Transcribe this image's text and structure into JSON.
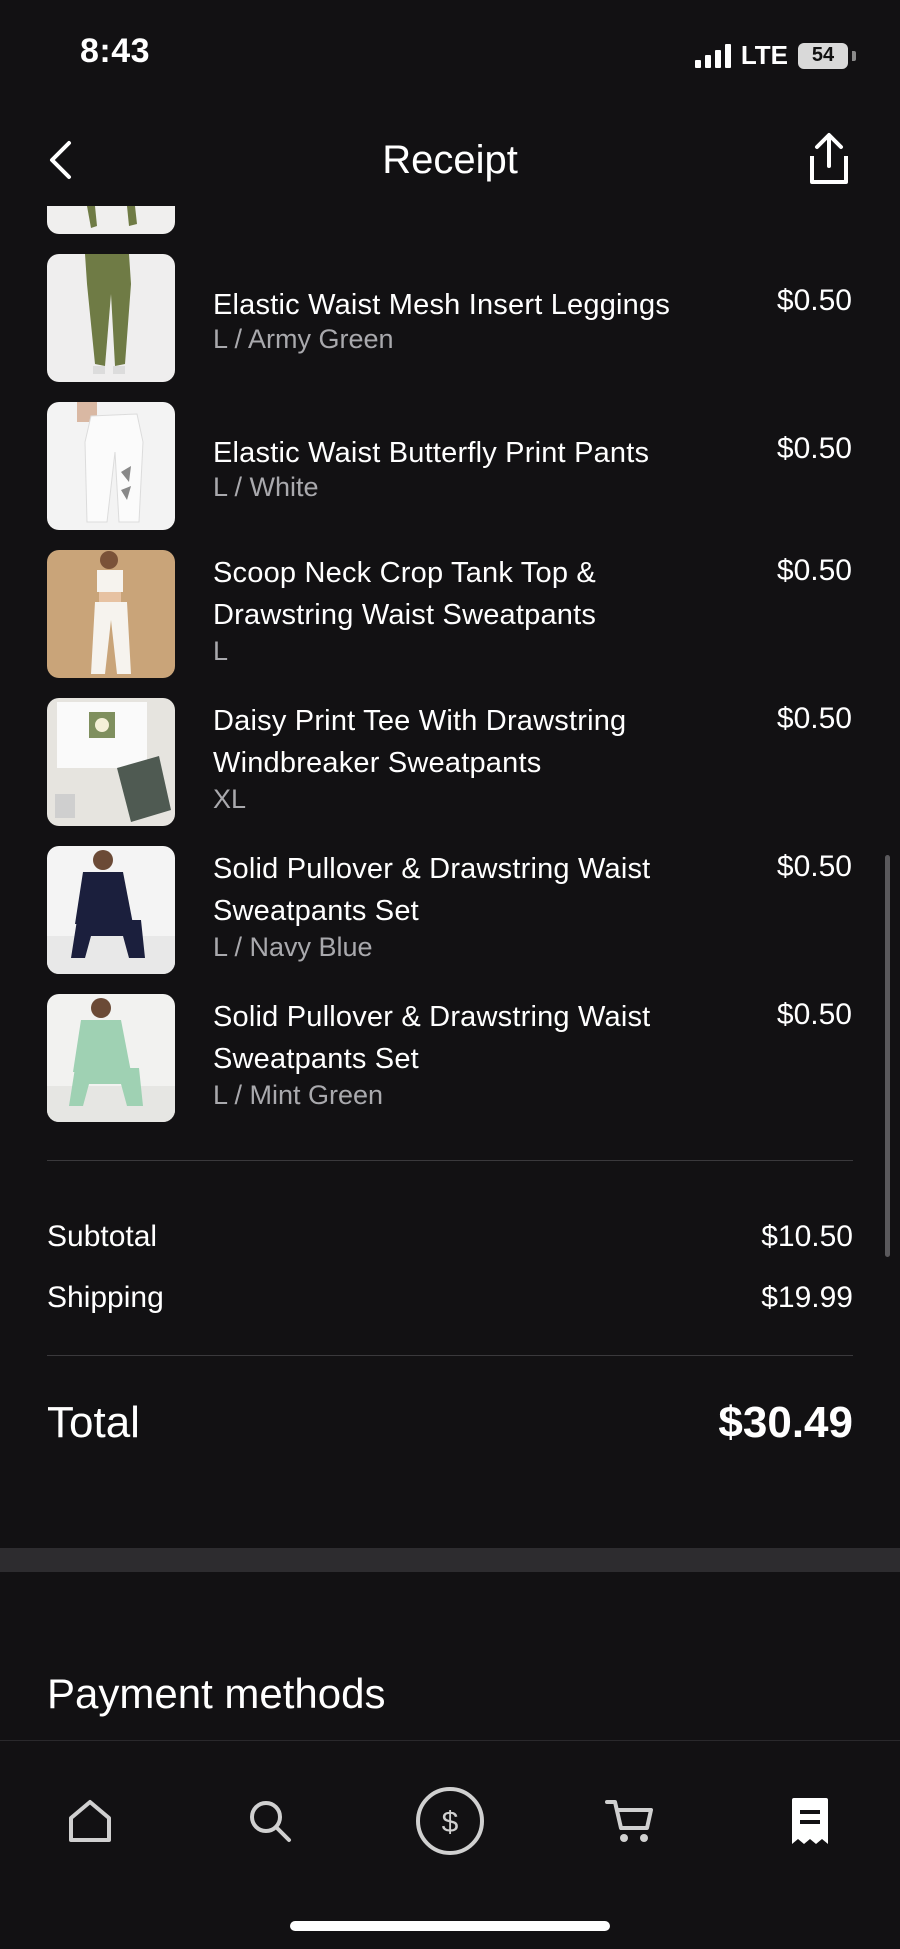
{
  "status_bar": {
    "time": "8:43",
    "network": "LTE",
    "battery": "54"
  },
  "header": {
    "title": "Receipt"
  },
  "items": [
    {
      "name": "Elastic Waist Mesh Insert Leggings",
      "variant": "L / Army Green",
      "price": "$0.50"
    },
    {
      "name": "Elastic Waist Butterfly Print Pants",
      "variant": "L / White",
      "price": "$0.50"
    },
    {
      "name": "Scoop Neck Crop Tank Top & Drawstring Waist Sweatpants",
      "variant": "L",
      "price": "$0.50"
    },
    {
      "name": "Daisy Print Tee With Drawstring Windbreaker Sweatpants",
      "variant": "XL",
      "price": "$0.50"
    },
    {
      "name": "Solid Pullover & Drawstring Waist Sweatpants Set",
      "variant": "L / Navy Blue",
      "price": "$0.50"
    },
    {
      "name": "Solid Pullover & Drawstring Waist Sweatpants Set",
      "variant": "L / Mint Green",
      "price": "$0.50"
    }
  ],
  "summary": {
    "subtotal_label": "Subtotal",
    "subtotal": "$10.50",
    "shipping_label": "Shipping",
    "shipping": "$19.99",
    "total_label": "Total",
    "total": "$30.49"
  },
  "payment": {
    "title": "Payment methods"
  },
  "bottom_nav": [
    "home-icon",
    "search-icon",
    "dollar-icon",
    "cart-icon",
    "receipt-icon"
  ],
  "colors": {
    "background": "#121113",
    "text": "#ffffff",
    "muted": "#a9a9ad"
  }
}
